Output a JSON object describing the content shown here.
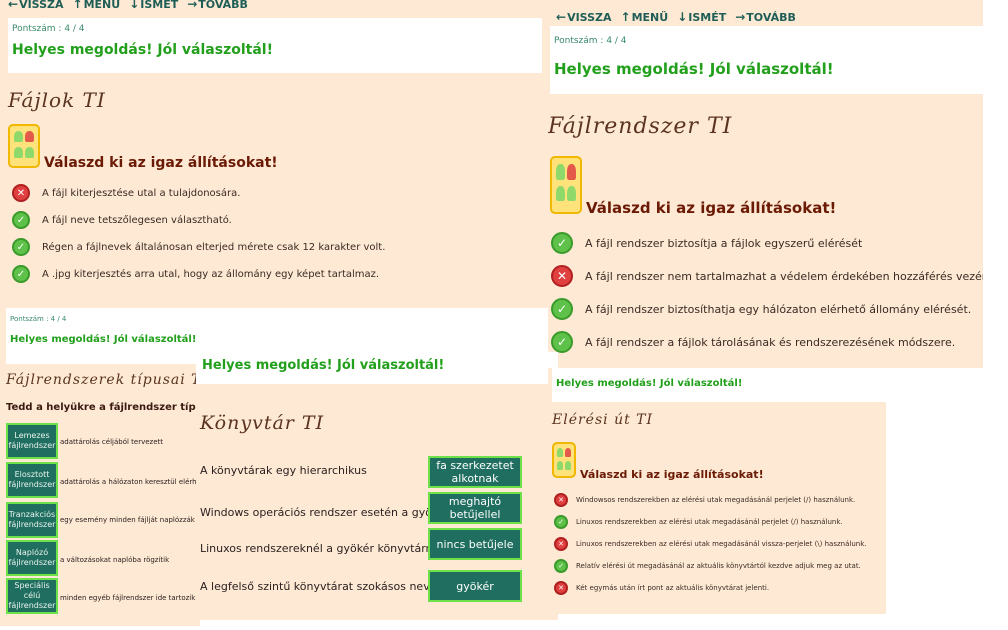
{
  "nav": {
    "back": "VISSZA",
    "menu": "MENÜ",
    "retry": "ISMÉT",
    "next": "TOVÁBB"
  },
  "icons": {
    "back": "arrow-left-icon",
    "menu": "arrow-up-icon",
    "retry": "arrow-down-icon",
    "next": "arrow-right-icon"
  },
  "score": {
    "label": "Pontszám :",
    "value": "4 / 4"
  },
  "score2": {
    "label": "Pontszám :",
    "value": "4 / 4"
  },
  "score3": {
    "label": "Pontszám : 4 / 4"
  },
  "success": "Helyes megoldás! Jól válaszoltál!",
  "q_instruction": "Válaszd ki az igaz állításokat!",
  "fajlok": {
    "title": "Fájlok TI",
    "items": [
      {
        "text": "A fájl kiterjesztése utal a tulajdonosára.",
        "correct": false
      },
      {
        "text": "A fájl neve tetszőlegesen választható.",
        "correct": true
      },
      {
        "text": "Régen a fájlnevek általánosan elterjed mérete csak 12 karakter volt.",
        "correct": true
      },
      {
        "text": "A .jpg kiterjesztés arra utal, hogy az állomány egy képet tartalmaz.",
        "correct": true
      }
    ]
  },
  "fajlrendszer": {
    "title": "Fájlrendszer TI",
    "items": [
      {
        "text": "A fájl rendszer biztosítja a fájlok egyszerű elérését",
        "correct": true
      },
      {
        "text": "A fájl rendszer nem tartalmazhat a védelem érdekében hozzáférés vezérlést",
        "correct": false
      },
      {
        "text": "A fájl rendszer biztosíthatja egy hálózaton elérhető állomány elérését.",
        "correct": true
      },
      {
        "text": "A fájl rendszer a fájlok tárolásának és rendszerezésének módszere.",
        "correct": true
      }
    ]
  },
  "tipusai": {
    "title": "Fájlrendszerek típusai TI",
    "instruction": "Tedd a helyükre a fájlrendszer típusokat!",
    "items": [
      {
        "button": "Lemezes fájlrendszer",
        "desc": "adattárolás céljából tervezett"
      },
      {
        "button": "Elosztott fájlrendszer",
        "desc": "adattárolás a hálózaton keresztül elérhető"
      },
      {
        "button": "Tranzakciós fájlrendszer",
        "desc": "egy esemény minden fájlját naplózzák"
      },
      {
        "button": "Naplózó fájlrendszer",
        "desc": "a változásokat naplóba rögzítik"
      },
      {
        "button": "Speciális célú fájlrendszer",
        "desc": "minden egyéb fájlrendszer ide tartozik"
      }
    ]
  },
  "konyvtar": {
    "title": "Könyvtár TI",
    "items": [
      {
        "text": "A könyvtárak egy hierarchikus",
        "answer": "fa szerkezetet alkotnak"
      },
      {
        "text": "Windows operációs rendszer esetén a gyökérkönyvtár egy",
        "answer": "meghajtó betűjellel"
      },
      {
        "text": "Linuxos rendszereknél a gyökér könyvtárnak",
        "answer": "nincs betűjele"
      },
      {
        "text": "A legfelső szintű könyvtárat szokásos neve",
        "answer": "gyökér"
      }
    ]
  },
  "eleresi": {
    "title": "Elérési út TI",
    "items": [
      {
        "text": "Windowsos rendszerekben az elérési utak megadásánál perjelet (/) használunk.",
        "correct": false
      },
      {
        "text": "Linuxos rendszerekben az elérési utak megadásánál perjelet (/) használunk.",
        "correct": true
      },
      {
        "text": "Linuxos rendszerekben az elérési utak megadásánál vissza-perjelet (\\) használunk.",
        "correct": false
      },
      {
        "text": "Relatív elérési út megadásánál az aktuális könyvtártól kezdve adjuk meg az utat.",
        "correct": true
      },
      {
        "text": "Két egymás után írt pont az aktuális könyvtárat jelenti.",
        "correct": false
      }
    ]
  },
  "colors": {
    "panel": "#fde9d4",
    "success": "#22a01c",
    "button": "#206e60",
    "button_border": "#6de04a"
  }
}
